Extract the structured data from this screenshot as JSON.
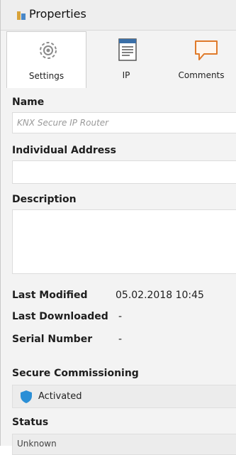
{
  "header": {
    "title": "Properties",
    "icon": "properties-icon"
  },
  "tabs": [
    {
      "label": "Settings",
      "icon": "gear-icon",
      "active": true
    },
    {
      "label": "IP",
      "icon": "ip-document-icon",
      "active": false
    },
    {
      "label": "Comments",
      "icon": "comment-bubble-icon",
      "active": false
    }
  ],
  "form": {
    "name_label": "Name",
    "name_placeholder": "KNX Secure IP Router",
    "address_label": "Individual Address",
    "address_value": "",
    "description_label": "Description",
    "description_value": "",
    "last_modified_label": "Last Modified",
    "last_modified_value": "05.02.2018 10:45",
    "last_downloaded_label": "Last Downloaded",
    "last_downloaded_value": "-",
    "serial_label": "Serial Number",
    "serial_value": "-",
    "secure_label": "Secure Commissioning",
    "secure_value": "Activated",
    "status_label": "Status",
    "status_value": "Unknown"
  },
  "colors": {
    "accent": "#2b8fd6",
    "tab_active_bg": "#ffffff",
    "panel_bg": "#f3f3f3"
  }
}
